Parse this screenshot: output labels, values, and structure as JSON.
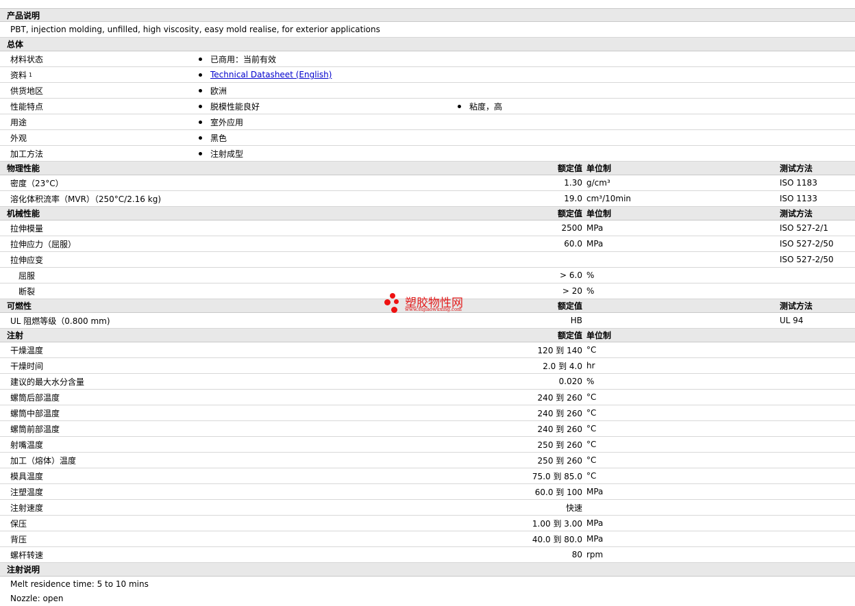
{
  "sections": {
    "desc": {
      "title": "产品说明",
      "text": "PBT, injection molding, unfilled, high viscosity, easy mold realise, for exterior applications"
    },
    "general": {
      "title": "总体",
      "rows": [
        {
          "label": "材料状态",
          "v1": "已商用：当前有效"
        },
        {
          "label": "资料",
          "sup": "1",
          "link": "Technical Datasheet (English)"
        },
        {
          "label": "供货地区",
          "v1": "欧洲"
        },
        {
          "label": "性能特点",
          "v1": "脱模性能良好",
          "v2": "粘度，高"
        },
        {
          "label": "用途",
          "v1": "室外应用"
        },
        {
          "label": "外观",
          "v1": "黑色"
        },
        {
          "label": "加工方法",
          "v1": "注射成型"
        }
      ]
    },
    "physical": {
      "title": "物理性能",
      "h_nominal": "额定值",
      "h_unit": "单位制",
      "h_test": "测试方法",
      "rows": [
        {
          "label": "密度（23°C）",
          "value": "1.30",
          "unit": "g/cm³",
          "test": "ISO 1183"
        },
        {
          "label": "溶化体积流率（MVR）（250°C/2.16 kg)",
          "value": "19.0",
          "unit": "cm³/10min",
          "test": "ISO 1133"
        }
      ]
    },
    "mechanical": {
      "title": "机械性能",
      "h_nominal": "额定值",
      "h_unit": "单位制",
      "h_test": "测试方法",
      "rows": [
        {
          "label": "拉伸模量",
          "value": "2500",
          "unit": "MPa",
          "test": "ISO 527-2/1"
        },
        {
          "label": "拉伸应力（屈服）",
          "value": "60.0",
          "unit": "MPa",
          "test": "ISO 527-2/50"
        },
        {
          "label": "拉伸应变",
          "value": "",
          "unit": "",
          "test": "ISO 527-2/50"
        },
        {
          "label": "屈服",
          "value": "> 6.0",
          "unit": "%",
          "test": "",
          "sub": true
        },
        {
          "label": "断裂",
          "value": "> 20",
          "unit": "%",
          "test": "",
          "sub": true
        }
      ]
    },
    "flammability": {
      "title": "可燃性",
      "h_nominal": "额定值",
      "h_test": "测试方法",
      "rows": [
        {
          "label": "UL 阻燃等级（0.800 mm)",
          "value": "HB",
          "unit": "",
          "test": "UL 94"
        }
      ]
    },
    "injection": {
      "title": "注射",
      "h_nominal": "额定值",
      "h_unit": "单位制",
      "rows": [
        {
          "label": "干燥温度",
          "value": "120 到  140",
          "unit": "°C"
        },
        {
          "label": "干燥时间",
          "value": "2.0 到  4.0",
          "unit": "hr"
        },
        {
          "label": "建议的最大水分含量",
          "value": "0.020",
          "unit": "%"
        },
        {
          "label": "螺筒后部温度",
          "value": "240 到  260",
          "unit": "°C"
        },
        {
          "label": "螺筒中部温度",
          "value": "240 到  260",
          "unit": "°C"
        },
        {
          "label": "螺筒前部温度",
          "value": "240 到  260",
          "unit": "°C"
        },
        {
          "label": "射嘴温度",
          "value": "250 到  260",
          "unit": "°C"
        },
        {
          "label": "加工（熔体）温度",
          "value": "250 到  260",
          "unit": "°C"
        },
        {
          "label": "模具温度",
          "value": "75.0 到  85.0",
          "unit": "°C"
        },
        {
          "label": "注塑温度",
          "value": "60.0 到  100",
          "unit": "MPa"
        },
        {
          "label": "注射速度",
          "value": "快速",
          "unit": ""
        },
        {
          "label": "保压",
          "value": "1.00 到  3.00",
          "unit": "MPa"
        },
        {
          "label": "背压",
          "value": "40.0 到  80.0",
          "unit": "MPa"
        },
        {
          "label": "螺杆转速",
          "value": "80",
          "unit": "rpm"
        }
      ]
    },
    "notes": {
      "title": "注射说明",
      "lines": [
        "Melt residence time: 5 to 10 mins",
        "Nozzle: open"
      ]
    }
  },
  "watermark": {
    "cn": "塑胶物性网",
    "en": "www.sujiaowuxing.com"
  }
}
